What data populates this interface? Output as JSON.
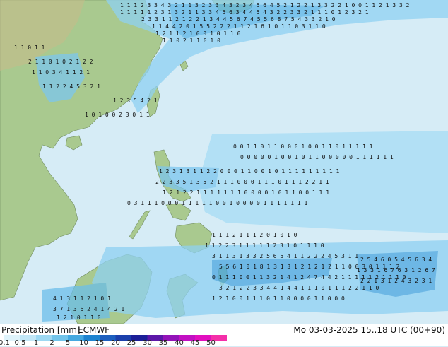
{
  "map": {
    "region": "Western Pacific / Philippines",
    "land_color": "#9fc28a",
    "sea_color": "#d6ecf6",
    "precip_color": "#7ec8ee"
  },
  "legend": {
    "title": "Precipitation [mm]",
    "source": "ECMWF",
    "valid_time": "Mo 03-03-2025 15..18 UTC (00+90)",
    "ticks": [
      "0.1",
      "0.5",
      "1",
      "2",
      "5",
      "10",
      "15",
      "20",
      "25",
      "30",
      "35",
      "40",
      "45",
      "50"
    ],
    "colors": [
      "#dff3fb",
      "#c2e7f7",
      "#9dd8f2",
      "#72c4ea",
      "#45a9e0",
      "#1e84d0",
      "#1d5fbf",
      "#1b3fab",
      "#1c1f98",
      "#5c17a8",
      "#9313b8",
      "#c210c3",
      "#e20fbf",
      "#f42fa9"
    ]
  }
}
